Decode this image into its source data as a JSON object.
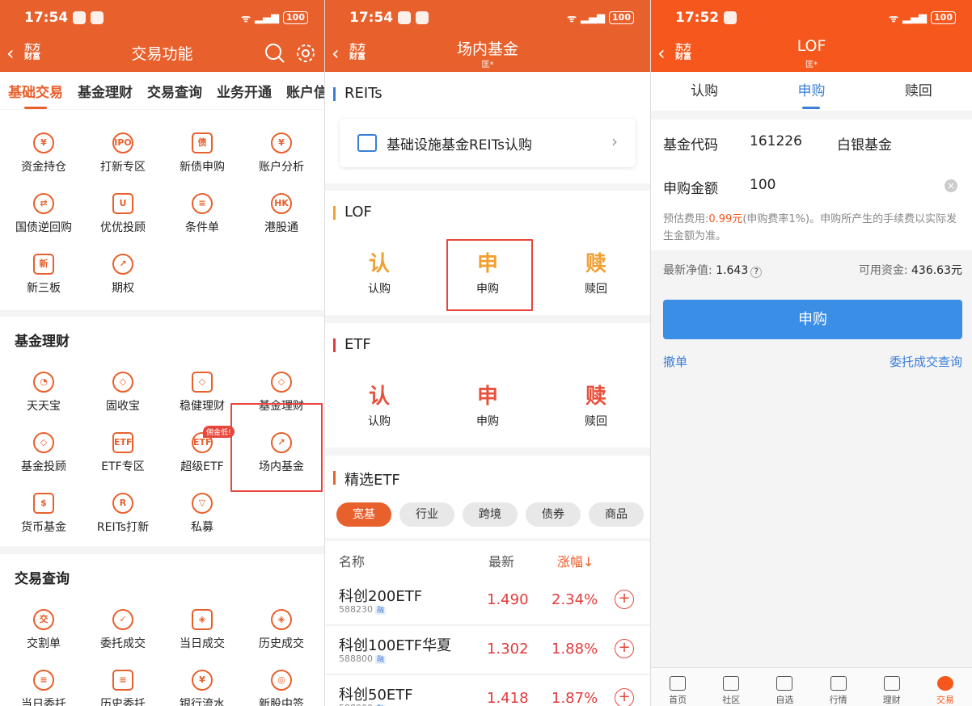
{
  "status": {
    "time1": "17:54",
    "time2": "17:54",
    "time3": "17:52",
    "battery": "100"
  },
  "panel1": {
    "logo": "东方\n财富",
    "title": "交易功能",
    "tabs": [
      "基础交易",
      "基金理财",
      "交易查询",
      "业务开通",
      "账户信"
    ],
    "basic_items": [
      {
        "label": "资金持仓",
        "glyph": "¥"
      },
      {
        "label": "打新专区",
        "glyph": "IPO"
      },
      {
        "label": "新债申购",
        "glyph": "债"
      },
      {
        "label": "账户分析",
        "glyph": "¥"
      },
      {
        "label": "国债逆回购",
        "glyph": "⇄"
      },
      {
        "label": "优优投顾",
        "glyph": "U"
      },
      {
        "label": "条件单",
        "glyph": "≡"
      },
      {
        "label": "港股通",
        "glyph": "HK"
      },
      {
        "label": "新三板",
        "glyph": "新"
      },
      {
        "label": "期权",
        "glyph": "↗"
      }
    ],
    "fund_title": "基金理财",
    "fund_items": [
      {
        "label": "天天宝",
        "glyph": "◔"
      },
      {
        "label": "固收宝",
        "glyph": "◇"
      },
      {
        "label": "稳健理财",
        "glyph": "◇"
      },
      {
        "label": "基金理财",
        "glyph": "◇"
      },
      {
        "label": "基金投顾",
        "glyph": "◇"
      },
      {
        "label": "ETF专区",
        "glyph": "ETF"
      },
      {
        "label": "超级ETF",
        "glyph": "ETF"
      },
      {
        "label": "场内基金",
        "glyph": "↗"
      },
      {
        "label": "货币基金",
        "glyph": "$"
      },
      {
        "label": "REITs打新",
        "glyph": "R"
      },
      {
        "label": "私募",
        "glyph": "▽"
      }
    ],
    "badge": "佣金低!",
    "query_title": "交易查询",
    "query_items": [
      {
        "label": "交割单",
        "glyph": "交"
      },
      {
        "label": "委托成交",
        "glyph": "✓"
      },
      {
        "label": "当日成交",
        "glyph": "◈"
      },
      {
        "label": "历史成交",
        "glyph": "◈"
      },
      {
        "label": "当日委托",
        "glyph": "≡"
      },
      {
        "label": "历史委托",
        "glyph": "≡"
      },
      {
        "label": "银行流水",
        "glyph": "¥"
      },
      {
        "label": "新股中签",
        "glyph": "◎"
      }
    ]
  },
  "panel2": {
    "title": "场内基金",
    "subtitle": "匡*",
    "reits_title": "REITs",
    "reits_card": "基础设施基金REITs认购",
    "lof_title": "LOF",
    "etf_title": "ETF",
    "actions": [
      {
        "big": "认",
        "label": "认购"
      },
      {
        "big": "申",
        "label": "申购"
      },
      {
        "big": "赎",
        "label": "赎回"
      }
    ],
    "featured_title": "精选ETF",
    "chips": [
      "宽基",
      "行业",
      "跨境",
      "债券",
      "商品"
    ],
    "columns": {
      "name": "名称",
      "latest": "最新",
      "change": "涨幅↓"
    },
    "etfs": [
      {
        "name": "科创200ETF",
        "code": "588230",
        "tag": "融",
        "price": "1.490",
        "change": "2.34%"
      },
      {
        "name": "科创100ETF华夏",
        "code": "588800",
        "tag": "融",
        "price": "1.302",
        "change": "1.88%"
      },
      {
        "name": "科创50ETF",
        "code": "588000",
        "tag": "融",
        "price": "1.418",
        "change": "1.87%"
      }
    ],
    "colors": {
      "reits": "#3a7ed8",
      "lof": "#f0a030",
      "etf": "#e23a3a",
      "featured": "#e8602c"
    }
  },
  "panel3": {
    "title": "LOF",
    "subtitle": "匡*",
    "tabs": [
      "认购",
      "申购",
      "赎回"
    ],
    "fund_code_label": "基金代码",
    "fund_code": "161226",
    "fund_name": "白银基金",
    "amount_label": "申购金额",
    "amount": "100",
    "fee_prefix": "预估费用:",
    "fee_value": "0.99元",
    "fee_suffix": "(申购费率1%)。申购所产生的手续费以实际发生金额为准。",
    "nav_label": "最新净值:",
    "nav_value": "1.643",
    "avail_label": "可用资金:",
    "avail_value": "436.63元",
    "submit": "申购",
    "cancel_link": "撤单",
    "query_link": "委托成交查询",
    "bottom_nav": [
      "首页",
      "社区",
      "自选",
      "行情",
      "理财",
      "交易"
    ]
  }
}
